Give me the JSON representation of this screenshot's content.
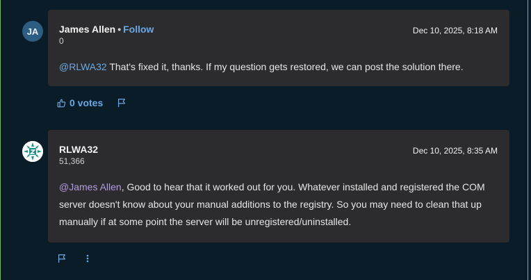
{
  "comments": [
    {
      "avatar_initials": "JA",
      "author": "James Allen",
      "separator": "•",
      "follow_label": "Follow",
      "reputation": "0",
      "date": "Dec 10, 2025, 8:18 AM",
      "mention": "@RLWA32",
      "text": " That's fixed it, thanks. If my question gets restored, we can post the solution there.",
      "votes_label": "0 votes",
      "icons": [
        "thumbs-up-icon",
        "flag-icon"
      ]
    },
    {
      "author": "RLWA32",
      "reputation": "51,366",
      "date": "Dec 10, 2025, 8:35 AM",
      "mention": "@James Allen",
      "text": ", Good to hear that it worked out for you. Whatever installed and registered the COM server doesn't know about your manual additions to the registry. So you may need to clean that up manually if at some point the server will be unregistered/uninstalled.",
      "icons": [
        "flag-icon",
        "more-options-icon"
      ]
    }
  ],
  "colors": {
    "background": "#0a1c27",
    "card": "#2c2c2e",
    "link": "#6ba9e4",
    "mention_purple": "#b39be0",
    "avatar_ja": "#2c5d82"
  }
}
